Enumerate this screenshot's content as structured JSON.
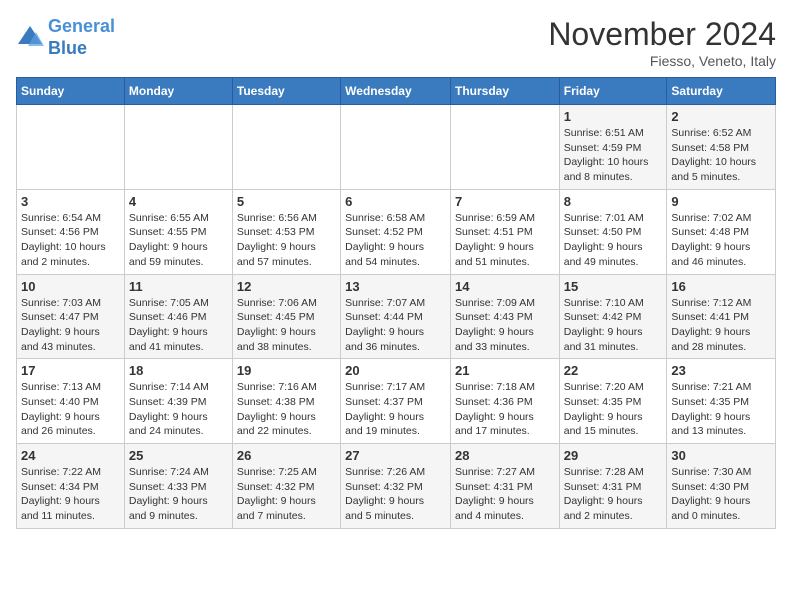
{
  "header": {
    "logo_line1": "General",
    "logo_line2": "Blue",
    "month_title": "November 2024",
    "location": "Fiesso, Veneto, Italy"
  },
  "weekdays": [
    "Sunday",
    "Monday",
    "Tuesday",
    "Wednesday",
    "Thursday",
    "Friday",
    "Saturday"
  ],
  "weeks": [
    [
      {
        "day": "",
        "info": ""
      },
      {
        "day": "",
        "info": ""
      },
      {
        "day": "",
        "info": ""
      },
      {
        "day": "",
        "info": ""
      },
      {
        "day": "",
        "info": ""
      },
      {
        "day": "1",
        "info": "Sunrise: 6:51 AM\nSunset: 4:59 PM\nDaylight: 10 hours\nand 8 minutes."
      },
      {
        "day": "2",
        "info": "Sunrise: 6:52 AM\nSunset: 4:58 PM\nDaylight: 10 hours\nand 5 minutes."
      }
    ],
    [
      {
        "day": "3",
        "info": "Sunrise: 6:54 AM\nSunset: 4:56 PM\nDaylight: 10 hours\nand 2 minutes."
      },
      {
        "day": "4",
        "info": "Sunrise: 6:55 AM\nSunset: 4:55 PM\nDaylight: 9 hours\nand 59 minutes."
      },
      {
        "day": "5",
        "info": "Sunrise: 6:56 AM\nSunset: 4:53 PM\nDaylight: 9 hours\nand 57 minutes."
      },
      {
        "day": "6",
        "info": "Sunrise: 6:58 AM\nSunset: 4:52 PM\nDaylight: 9 hours\nand 54 minutes."
      },
      {
        "day": "7",
        "info": "Sunrise: 6:59 AM\nSunset: 4:51 PM\nDaylight: 9 hours\nand 51 minutes."
      },
      {
        "day": "8",
        "info": "Sunrise: 7:01 AM\nSunset: 4:50 PM\nDaylight: 9 hours\nand 49 minutes."
      },
      {
        "day": "9",
        "info": "Sunrise: 7:02 AM\nSunset: 4:48 PM\nDaylight: 9 hours\nand 46 minutes."
      }
    ],
    [
      {
        "day": "10",
        "info": "Sunrise: 7:03 AM\nSunset: 4:47 PM\nDaylight: 9 hours\nand 43 minutes."
      },
      {
        "day": "11",
        "info": "Sunrise: 7:05 AM\nSunset: 4:46 PM\nDaylight: 9 hours\nand 41 minutes."
      },
      {
        "day": "12",
        "info": "Sunrise: 7:06 AM\nSunset: 4:45 PM\nDaylight: 9 hours\nand 38 minutes."
      },
      {
        "day": "13",
        "info": "Sunrise: 7:07 AM\nSunset: 4:44 PM\nDaylight: 9 hours\nand 36 minutes."
      },
      {
        "day": "14",
        "info": "Sunrise: 7:09 AM\nSunset: 4:43 PM\nDaylight: 9 hours\nand 33 minutes."
      },
      {
        "day": "15",
        "info": "Sunrise: 7:10 AM\nSunset: 4:42 PM\nDaylight: 9 hours\nand 31 minutes."
      },
      {
        "day": "16",
        "info": "Sunrise: 7:12 AM\nSunset: 4:41 PM\nDaylight: 9 hours\nand 28 minutes."
      }
    ],
    [
      {
        "day": "17",
        "info": "Sunrise: 7:13 AM\nSunset: 4:40 PM\nDaylight: 9 hours\nand 26 minutes."
      },
      {
        "day": "18",
        "info": "Sunrise: 7:14 AM\nSunset: 4:39 PM\nDaylight: 9 hours\nand 24 minutes."
      },
      {
        "day": "19",
        "info": "Sunrise: 7:16 AM\nSunset: 4:38 PM\nDaylight: 9 hours\nand 22 minutes."
      },
      {
        "day": "20",
        "info": "Sunrise: 7:17 AM\nSunset: 4:37 PM\nDaylight: 9 hours\nand 19 minutes."
      },
      {
        "day": "21",
        "info": "Sunrise: 7:18 AM\nSunset: 4:36 PM\nDaylight: 9 hours\nand 17 minutes."
      },
      {
        "day": "22",
        "info": "Sunrise: 7:20 AM\nSunset: 4:35 PM\nDaylight: 9 hours\nand 15 minutes."
      },
      {
        "day": "23",
        "info": "Sunrise: 7:21 AM\nSunset: 4:35 PM\nDaylight: 9 hours\nand 13 minutes."
      }
    ],
    [
      {
        "day": "24",
        "info": "Sunrise: 7:22 AM\nSunset: 4:34 PM\nDaylight: 9 hours\nand 11 minutes."
      },
      {
        "day": "25",
        "info": "Sunrise: 7:24 AM\nSunset: 4:33 PM\nDaylight: 9 hours\nand 9 minutes."
      },
      {
        "day": "26",
        "info": "Sunrise: 7:25 AM\nSunset: 4:32 PM\nDaylight: 9 hours\nand 7 minutes."
      },
      {
        "day": "27",
        "info": "Sunrise: 7:26 AM\nSunset: 4:32 PM\nDaylight: 9 hours\nand 5 minutes."
      },
      {
        "day": "28",
        "info": "Sunrise: 7:27 AM\nSunset: 4:31 PM\nDaylight: 9 hours\nand 4 minutes."
      },
      {
        "day": "29",
        "info": "Sunrise: 7:28 AM\nSunset: 4:31 PM\nDaylight: 9 hours\nand 2 minutes."
      },
      {
        "day": "30",
        "info": "Sunrise: 7:30 AM\nSunset: 4:30 PM\nDaylight: 9 hours\nand 0 minutes."
      }
    ]
  ]
}
